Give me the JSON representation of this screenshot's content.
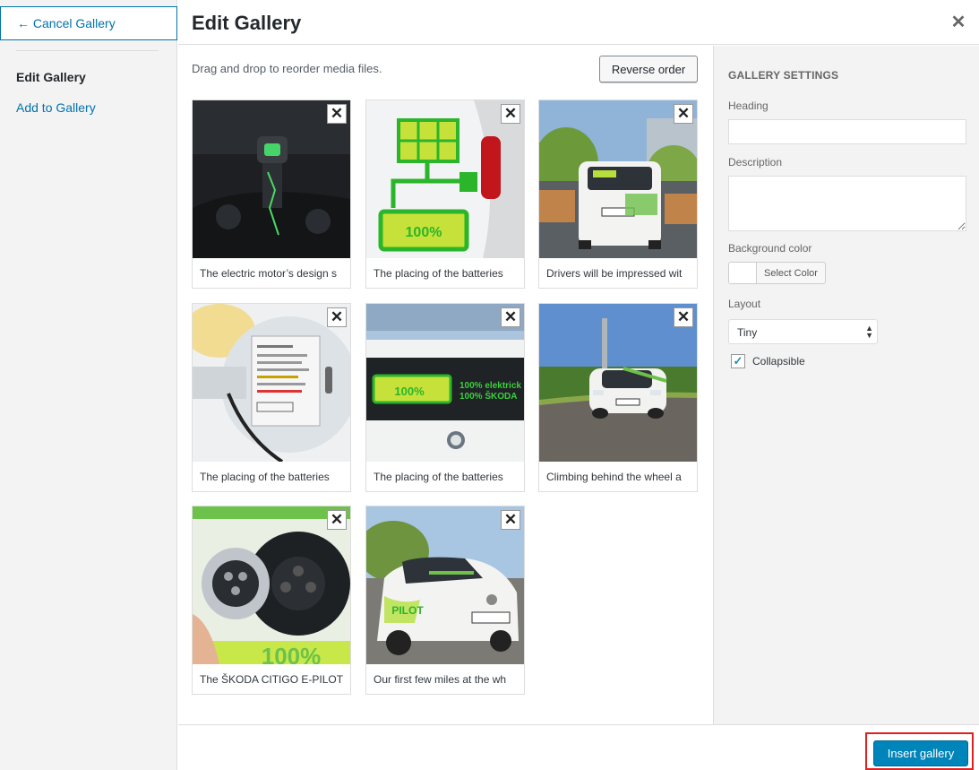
{
  "sidebar": {
    "cancel_label": "← Cancel Gallery",
    "current_item": "Edit Gallery",
    "add_item": "Add to Gallery"
  },
  "header": {
    "title": "Edit Gallery",
    "close_label": "✕"
  },
  "main": {
    "instructions": "Drag and drop to reorder media files.",
    "reverse_label": "Reverse order",
    "remove_label": "✕",
    "items": [
      {
        "caption": "The electric motor’s design s"
      },
      {
        "caption": "The placing of the batteries"
      },
      {
        "caption": "Drivers will be impressed wit"
      },
      {
        "caption": "The placing of the batteries"
      },
      {
        "caption": "The placing of the batteries"
      },
      {
        "caption": "Climbing behind the wheel a"
      },
      {
        "caption": "The ŠKODA CITIGO E-PILOT"
      },
      {
        "caption": "Our first few miles at the wh"
      }
    ]
  },
  "settings": {
    "heading": "GALLERY SETTINGS",
    "heading_label": "Heading",
    "heading_value": "",
    "description_label": "Description",
    "description_value": "",
    "bg_color_label": "Background color",
    "select_color_label": "Select Color",
    "layout_label": "Layout",
    "layout_value": "Tiny",
    "collapsible_label": "Collapsible",
    "collapsible_checked": true
  },
  "footer": {
    "insert_label": "Insert gallery"
  },
  "colors": {
    "accent": "#0073aa",
    "primary_button": "#0085ba",
    "highlight": "#e02020"
  }
}
